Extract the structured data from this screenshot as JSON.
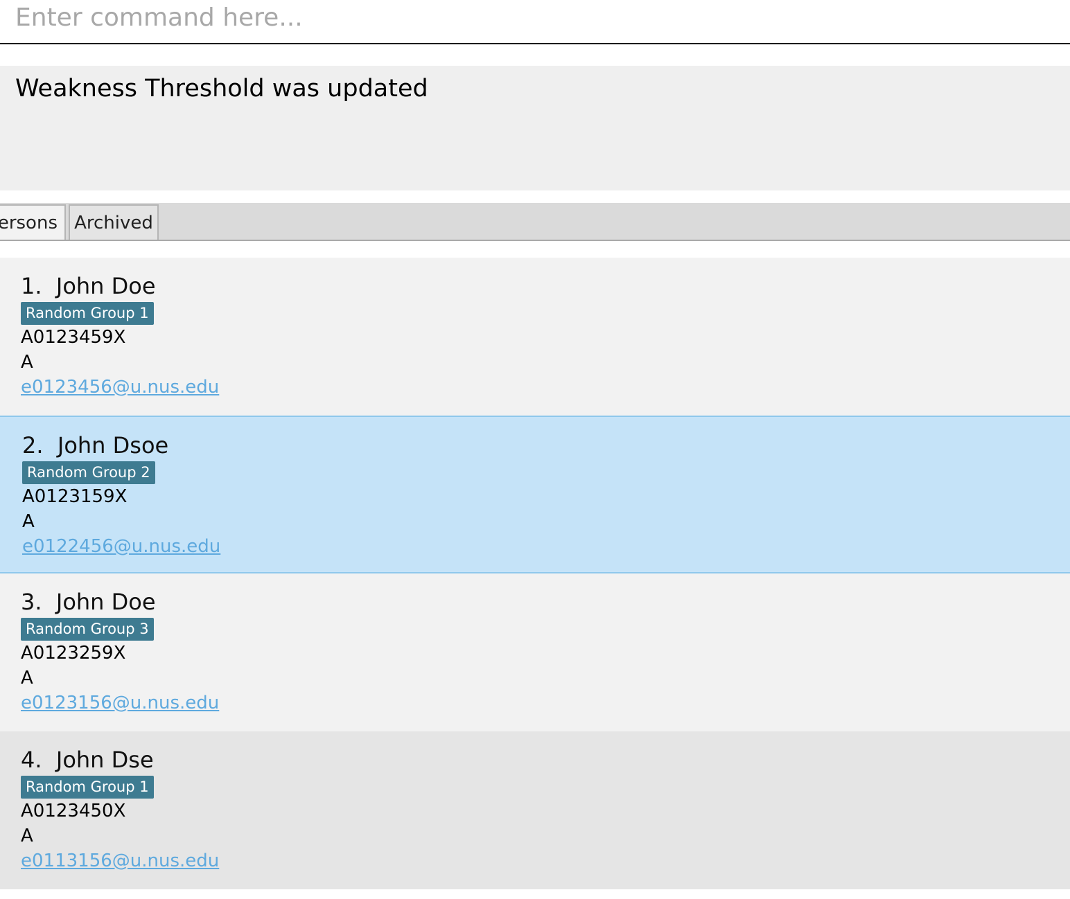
{
  "command": {
    "placeholder": "Enter command here...",
    "value": ""
  },
  "result": {
    "message": "Weakness Threshold was updated"
  },
  "tabs": [
    {
      "label": "Persons",
      "selected": true
    },
    {
      "label": "Archived",
      "selected": false
    }
  ],
  "persons": [
    {
      "index": "1.",
      "name": "John Doe",
      "tag": "Random Group 1",
      "matric": "A0123459X",
      "grade": "A",
      "email": "e0123456@u.nus.edu"
    },
    {
      "index": "2.",
      "name": "John Dsoe",
      "tag": "Random Group 2",
      "matric": "A0123159X",
      "grade": "A",
      "email": "e0122456@u.nus.edu"
    },
    {
      "index": "3.",
      "name": "John Doe",
      "tag": "Random Group 3",
      "matric": "A0123259X",
      "grade": "A",
      "email": "e0123156@u.nus.edu"
    },
    {
      "index": "4.",
      "name": "John Dse",
      "tag": "Random Group 1",
      "matric": "A0123450X",
      "grade": "A",
      "email": "e0113156@u.nus.edu"
    }
  ],
  "colors": {
    "tag_background": "#3e7b91",
    "selected_card": "#c5e3f8",
    "email_link": "#5ea9de"
  }
}
